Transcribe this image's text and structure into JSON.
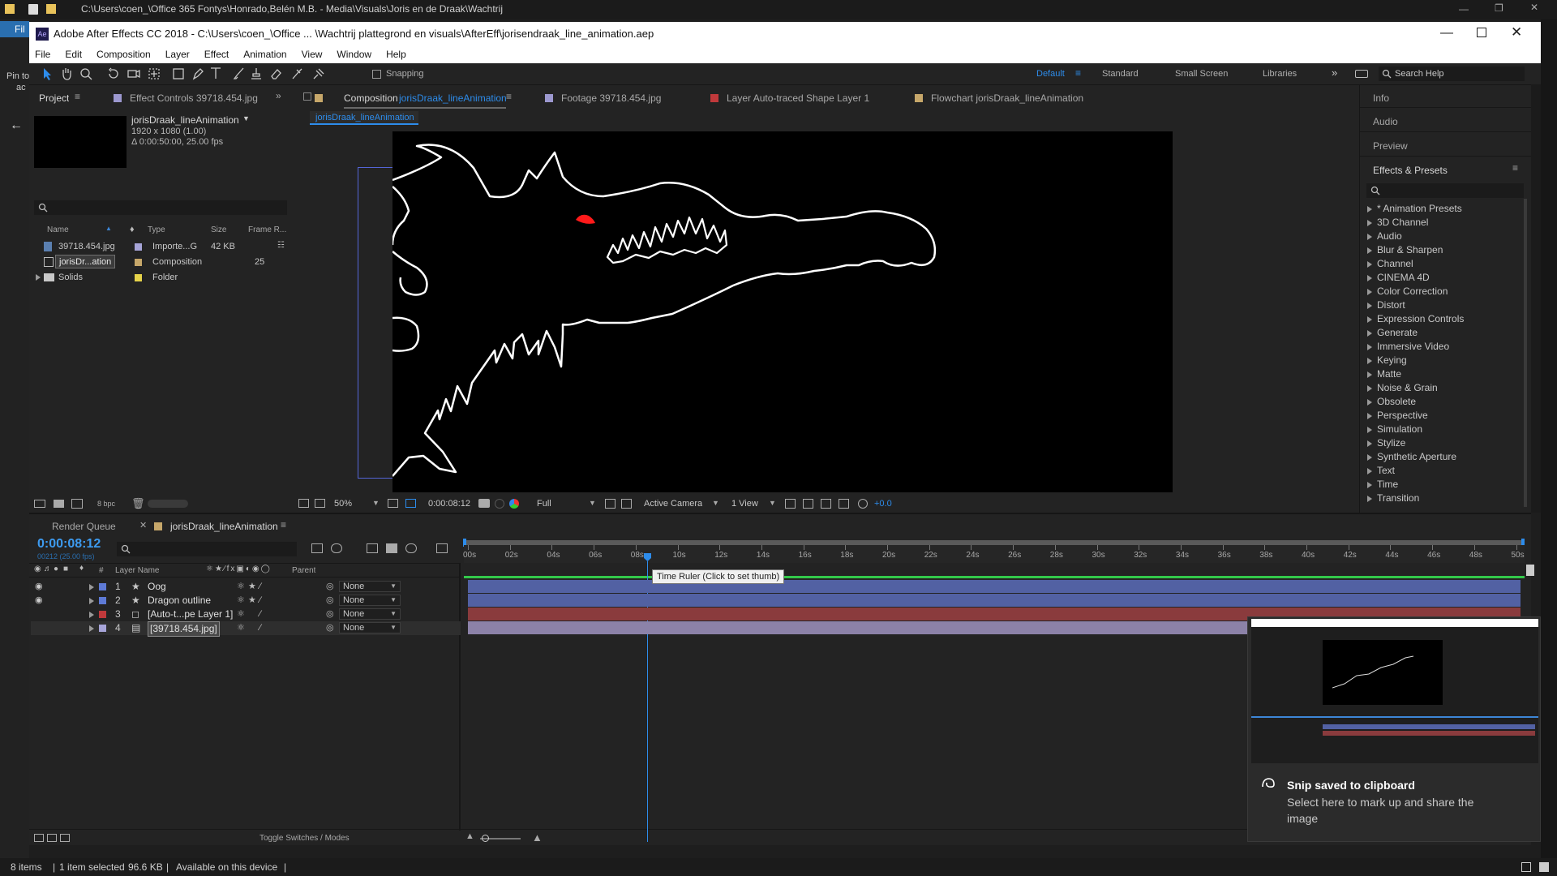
{
  "explorer": {
    "title": "C:\\Users\\coen_\\Office 365 Fontys\\Honrado,Belén M.B. - Media\\Visuals\\Joris en de Draak\\Wachtrij",
    "left_fragments": [
      "Fil",
      "Pin to",
      "ac"
    ]
  },
  "ae": {
    "title": "Adobe After Effects CC 2018 - C:\\Users\\coen_\\Office ... \\Wachtrij plattegrond en visuals\\AfterEff\\jorisendraak_line_animation.aep",
    "menu": [
      "File",
      "Edit",
      "Composition",
      "Layer",
      "Effect",
      "Animation",
      "View",
      "Window",
      "Help"
    ],
    "toolbar": {
      "snapping": "Snapping",
      "workspaces": [
        "Default",
        "Standard",
        "Small Screen",
        "Libraries"
      ],
      "search": "Search Help"
    },
    "project": {
      "tab": "Project",
      "effect_tab": "Effect Controls 39718.454.jpg",
      "comp_name": "jorisDraak_lineAnimation",
      "comp_res": "1920 x 1080 (1.00)",
      "comp_dur": "Δ 0:00:50:00, 25.00 fps",
      "columns": [
        "Name",
        "Type",
        "Size",
        "Frame R..."
      ],
      "items": [
        {
          "name": "39718.454.jpg",
          "type": "Importe...G",
          "size": "42 KB",
          "fr": ""
        },
        {
          "name": "jorisDr...ation",
          "type": "Composition",
          "size": "",
          "fr": "25"
        },
        {
          "name": "Solids",
          "type": "Folder",
          "size": "",
          "fr": ""
        }
      ],
      "bpc": "8 bpc"
    },
    "viewer_tabs": {
      "composition": "Composition",
      "composition_name": "jorisDraak_lineAnimation",
      "footage": "Footage 39718.454.jpg",
      "layer": "Layer Auto-traced Shape Layer 1",
      "flowchart": "Flowchart jorisDraak_lineAnimation",
      "breadcrumb": "jorisDraak_lineAnimation"
    },
    "viewer_bar": {
      "zoom": "50%",
      "time": "0:00:08:12",
      "resolution": "Full",
      "camera": "Active Camera",
      "views": "1 View",
      "exposure": "+0.0"
    },
    "right_panel": {
      "info": "Info",
      "audio": "Audio",
      "preview": "Preview",
      "effects_title": "Effects & Presets",
      "effects": [
        "* Animation Presets",
        "3D Channel",
        "Audio",
        "Blur & Sharpen",
        "Channel",
        "CINEMA 4D",
        "Color Correction",
        "Distort",
        "Expression Controls",
        "Generate",
        "Immersive Video",
        "Keying",
        "Matte",
        "Noise & Grain",
        "Obsolete",
        "Perspective",
        "Simulation",
        "Stylize",
        "Synthetic Aperture",
        "Text",
        "Time",
        "Transition"
      ]
    },
    "timeline": {
      "render_queue": "Render Queue",
      "comp_tab": "jorisDraak_lineAnimation",
      "timecode": "0:00:08:12",
      "timecode_sub": "00212 (25.00 fps)",
      "col_layer": "Layer Name",
      "col_parent": "Parent",
      "col_num": "#",
      "layers": [
        {
          "num": "1",
          "name": "Oog",
          "parent": "None"
        },
        {
          "num": "2",
          "name": "Dragon outline",
          "parent": "None"
        },
        {
          "num": "3",
          "name": "[Auto-t...pe Layer 1]",
          "parent": "None"
        },
        {
          "num": "4",
          "name": "[39718.454.jpg]",
          "parent": "None"
        }
      ],
      "ticks": [
        "00s",
        "02s",
        "04s",
        "06s",
        "08s",
        "10s",
        "12s",
        "14s",
        "16s",
        "18s",
        "20s",
        "22s",
        "24s",
        "26s",
        "28s",
        "30s",
        "32s",
        "34s",
        "36s",
        "38s",
        "40s",
        "42s",
        "44s",
        "46s",
        "48s",
        "50s"
      ],
      "tooltip": "Time Ruler (Click to set thumb)",
      "toggle": "Toggle Switches / Modes"
    },
    "status": {
      "items": "8 items",
      "selected": "1 item selected",
      "size": "96.6 KB",
      "availability": "Available on this device"
    }
  },
  "notification": {
    "title": "Snip saved to clipboard",
    "body": "Select here to mark up and share the image"
  }
}
